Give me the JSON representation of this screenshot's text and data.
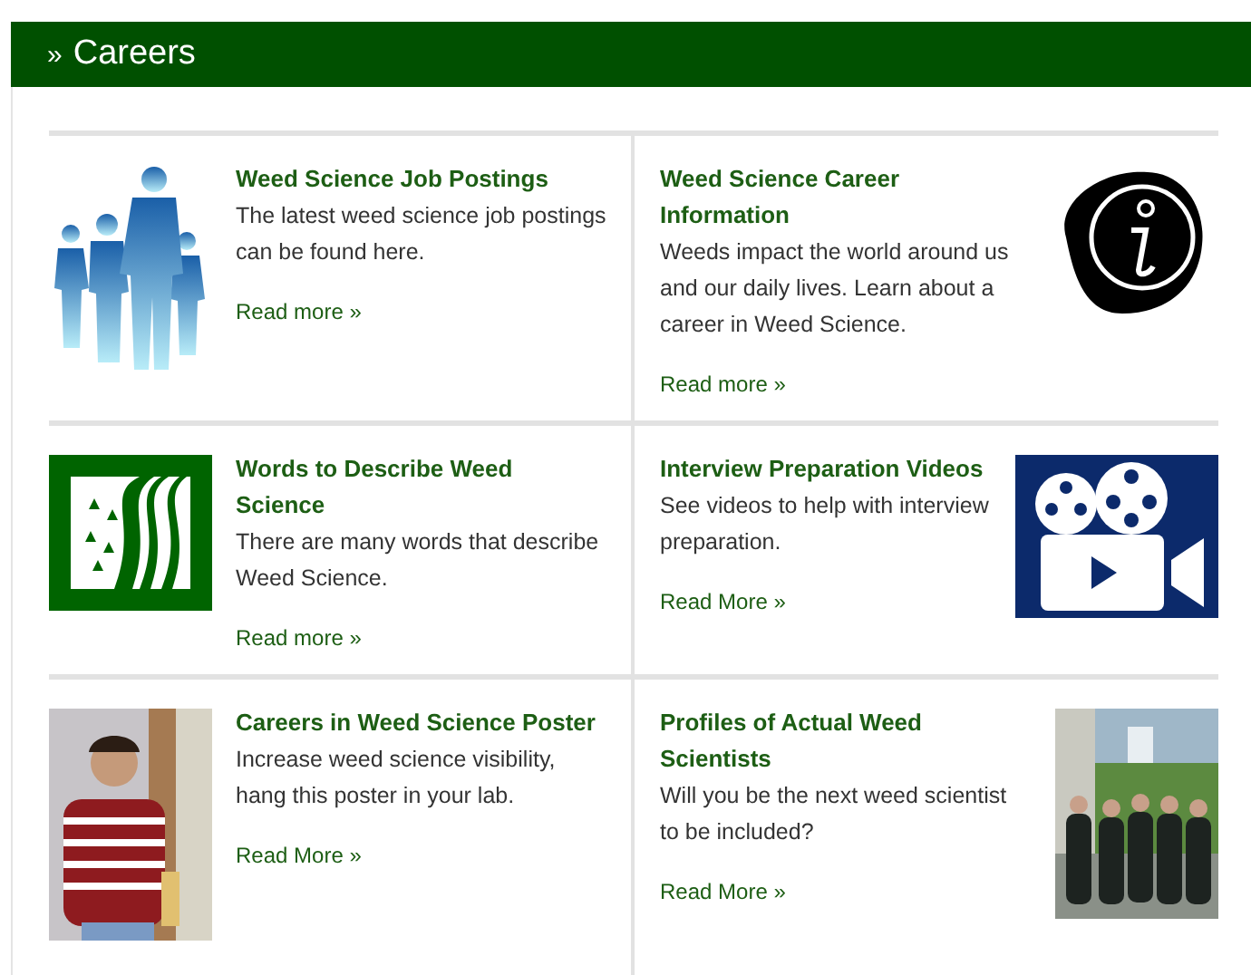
{
  "header": {
    "marker": "»",
    "title": "Careers"
  },
  "cards": [
    {
      "title": "Weed Science Job Postings",
      "text": "The latest weed science job postings can be found here.",
      "link": "Read more »",
      "image": {
        "kind": "people"
      }
    },
    {
      "title": "Weed Science Career Information",
      "text": "Weeds impact the world around us and our daily lives. Learn about a career in Weed Science.",
      "link": "Read more »",
      "image": {
        "kind": "info"
      }
    },
    {
      "title": "Words to Describe Weed Science",
      "text": "There are many words that describe Weed Science.",
      "link": "Read more »",
      "image": {
        "kind": "road"
      }
    },
    {
      "title": "Interview Preparation Videos",
      "text": "See videos to help with interview preparation.",
      "link": "Read More »",
      "image": {
        "kind": "film"
      }
    },
    {
      "title": "Careers in Weed Science Poster",
      "text": "Increase weed science visibility, hang this poster in your lab.",
      "link": "Read More »"
    },
    {
      "title": "Profiles of Actual Weed Scientists",
      "text": "Will you be the next weed scientist to be included?",
      "link": "Read More »"
    }
  ]
}
